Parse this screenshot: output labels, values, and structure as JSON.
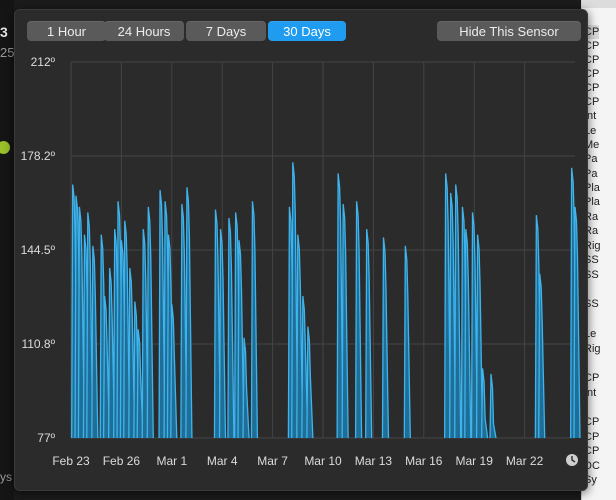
{
  "left_edge": {
    "fragment_1": "3",
    "fragment_2": "25",
    "fragment_3": "ys"
  },
  "right_list": {
    "items": [
      "CP",
      "CP",
      "CP",
      "CP",
      "CP",
      "CP",
      "Int",
      "Le",
      "Me",
      "Pa",
      "Pa",
      "Pla",
      "Pla",
      "Ra",
      "Ra",
      "Rig",
      "SS",
      "SS",
      "SS",
      "Le",
      "Rig",
      "CP",
      "Int",
      "CP",
      "CP",
      "CP",
      "DC",
      "Sy"
    ]
  },
  "toolbar": {
    "ranges": [
      {
        "label": "1 Hour",
        "active": false
      },
      {
        "label": "24 Hours",
        "active": false
      },
      {
        "label": "7 Days",
        "active": false
      },
      {
        "label": "30 Days",
        "active": true
      }
    ],
    "hide_label": "Hide This Sensor"
  },
  "colors": {
    "accent": "#1f9bf0",
    "series_stroke": "#3fb4ec",
    "series_fill": "#1e6e98",
    "grid": "#444444"
  },
  "chart_data": {
    "type": "area",
    "title": "",
    "xlabel": "",
    "ylabel": "",
    "ylim": [
      77,
      212
    ],
    "y_ticks": [
      "212º",
      "178.2º",
      "144.5º",
      "110.8º",
      "77º"
    ],
    "x_ticks": [
      "Feb 23",
      "Feb 26",
      "Mar 1",
      "Mar 4",
      "Mar 7",
      "Mar 10",
      "Mar 13",
      "Mar 16",
      "Mar 19",
      "Mar 22"
    ],
    "x_range_days": [
      0,
      30
    ],
    "series": [
      {
        "spikes": [
          {
            "x": 0.1,
            "peak": 168
          },
          {
            "x": 0.3,
            "peak": 164
          },
          {
            "x": 0.5,
            "peak": 160
          },
          {
            "x": 0.8,
            "peak": 150
          },
          {
            "x": 1.0,
            "peak": 158
          },
          {
            "x": 1.3,
            "peak": 146
          },
          {
            "x": 1.8,
            "peak": 150
          },
          {
            "x": 2.0,
            "peak": 128
          },
          {
            "x": 2.3,
            "peak": 138
          },
          {
            "x": 2.6,
            "peak": 152
          },
          {
            "x": 2.8,
            "peak": 162
          },
          {
            "x": 3.0,
            "peak": 148
          },
          {
            "x": 3.2,
            "peak": 155
          },
          {
            "x": 3.5,
            "peak": 138
          },
          {
            "x": 3.8,
            "peak": 126
          },
          {
            "x": 4.0,
            "peak": 116
          },
          {
            "x": 4.3,
            "peak": 152
          },
          {
            "x": 4.6,
            "peak": 160
          },
          {
            "x": 5.3,
            "peak": 166
          },
          {
            "x": 5.6,
            "peak": 162
          },
          {
            "x": 5.8,
            "peak": 150
          },
          {
            "x": 6.0,
            "peak": 125
          },
          {
            "x": 6.6,
            "peak": 161
          },
          {
            "x": 6.9,
            "peak": 167
          },
          {
            "x": 8.6,
            "peak": 159
          },
          {
            "x": 8.9,
            "peak": 152
          },
          {
            "x": 9.4,
            "peak": 156
          },
          {
            "x": 9.8,
            "peak": 158
          },
          {
            "x": 10.0,
            "peak": 148
          },
          {
            "x": 10.3,
            "peak": 113
          },
          {
            "x": 10.8,
            "peak": 162
          },
          {
            "x": 13.0,
            "peak": 160
          },
          {
            "x": 13.2,
            "peak": 176
          },
          {
            "x": 13.5,
            "peak": 150
          },
          {
            "x": 13.8,
            "peak": 128
          },
          {
            "x": 14.1,
            "peak": 117
          },
          {
            "x": 15.9,
            "peak": 172
          },
          {
            "x": 16.2,
            "peak": 161
          },
          {
            "x": 17.0,
            "peak": 162
          },
          {
            "x": 17.6,
            "peak": 152
          },
          {
            "x": 18.6,
            "peak": 149
          },
          {
            "x": 19.9,
            "peak": 146
          },
          {
            "x": 22.3,
            "peak": 172
          },
          {
            "x": 22.6,
            "peak": 165
          },
          {
            "x": 22.9,
            "peak": 168
          },
          {
            "x": 23.3,
            "peak": 160
          },
          {
            "x": 23.5,
            "peak": 152
          },
          {
            "x": 23.9,
            "peak": 158
          },
          {
            "x": 24.2,
            "peak": 150
          },
          {
            "x": 24.5,
            "peak": 102
          },
          {
            "x": 25.0,
            "peak": 100
          },
          {
            "x": 27.7,
            "peak": 157
          },
          {
            "x": 27.9,
            "peak": 136
          },
          {
            "x": 29.8,
            "peak": 174
          },
          {
            "x": 30.0,
            "peak": 160
          }
        ]
      }
    ]
  }
}
